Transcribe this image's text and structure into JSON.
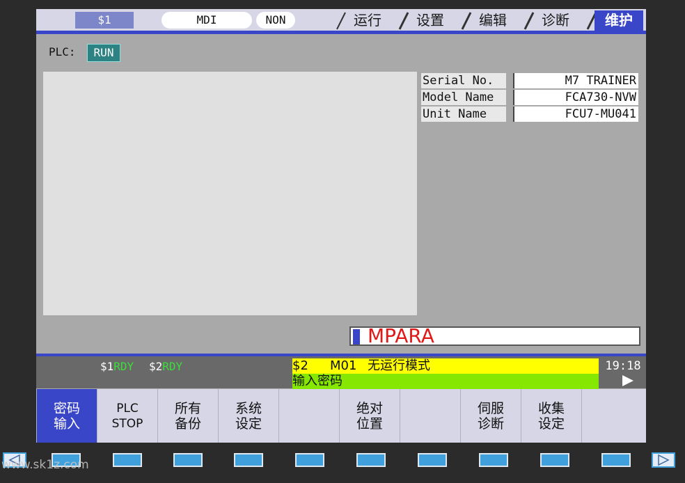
{
  "header": {
    "system": "$1",
    "mode": "MDI",
    "sub_mode": "NON",
    "tabs": [
      {
        "label": "运行",
        "active": false
      },
      {
        "label": "设置",
        "active": false
      },
      {
        "label": "编辑",
        "active": false
      },
      {
        "label": "诊断",
        "active": false
      },
      {
        "label": "维护",
        "active": true
      }
    ]
  },
  "plc": {
    "label": "PLC:",
    "status": "RUN"
  },
  "info": [
    {
      "key": "Serial No.",
      "value": "M7 TRAINER"
    },
    {
      "key": "Model Name",
      "value": "FCA730-NVW"
    },
    {
      "key": "Unit Name",
      "value": "FCU7-MU041"
    }
  ],
  "input": {
    "value": "MPARA"
  },
  "status_bar": {
    "sys1": "$1",
    "sys1_state": "RDY",
    "sys2": "$2",
    "sys2_state": "RDY",
    "line1_sys": "$2",
    "line1_code": "M01",
    "line1_text": "无运行模式",
    "line2_text": "输入密码",
    "time": "19:18"
  },
  "softkeys": [
    {
      "line1": "密码",
      "line2": "输入",
      "active": true
    },
    {
      "line1": "PLC",
      "line2": "STOP",
      "active": false
    },
    {
      "line1": "所有",
      "line2": "备份",
      "active": false
    },
    {
      "line1": "系统",
      "line2": "设定",
      "active": false
    },
    {
      "line1": "",
      "line2": "",
      "active": false
    },
    {
      "line1": "绝对",
      "line2": "位置",
      "active": false
    },
    {
      "line1": "",
      "line2": "",
      "active": false
    },
    {
      "line1": "伺服",
      "line2": "诊断",
      "active": false
    },
    {
      "line1": "收集",
      "line2": "设定",
      "active": false
    },
    {
      "line1": "",
      "line2": "",
      "active": false
    }
  ],
  "watermark": "www.sk1z.com",
  "colors": {
    "accent": "#3a46c8",
    "plc_run": "#2d8383",
    "alarm_yellow": "#ffff00",
    "guide_green": "#86e800",
    "rdy_green": "#3bde3b",
    "input_red": "#e01818"
  }
}
